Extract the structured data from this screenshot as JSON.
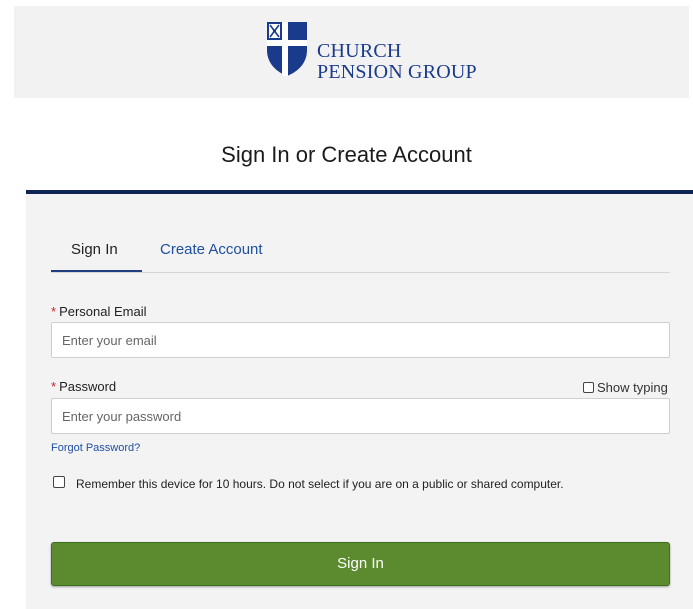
{
  "brand": {
    "line1": "CHURCH",
    "line2": "PENSION GROUP",
    "logo_icon": "shield-cross-icon",
    "color": "#1a3a8c"
  },
  "page_title": "Sign In or Create Account",
  "tabs": [
    {
      "label": "Sign In",
      "active": true
    },
    {
      "label": "Create Account",
      "active": false
    }
  ],
  "form": {
    "email": {
      "required_marker": "*",
      "label": "Personal Email",
      "placeholder": "Enter your email",
      "value": ""
    },
    "password": {
      "required_marker": "*",
      "label": "Password",
      "placeholder": "Enter your password",
      "value": "",
      "show_typing_label": "Show typing",
      "show_typing_checked": false
    },
    "forgot_password": "Forgot Password?",
    "remember": {
      "label": "Remember this device for 10 hours. Do not select if you are on a public or shared computer.",
      "checked": false
    },
    "submit_label": "Sign In"
  },
  "colors": {
    "accent_navy": "#0d2454",
    "link_blue": "#1f4fa0",
    "button_green": "#5b8b2e",
    "required_red": "#cc2222"
  }
}
